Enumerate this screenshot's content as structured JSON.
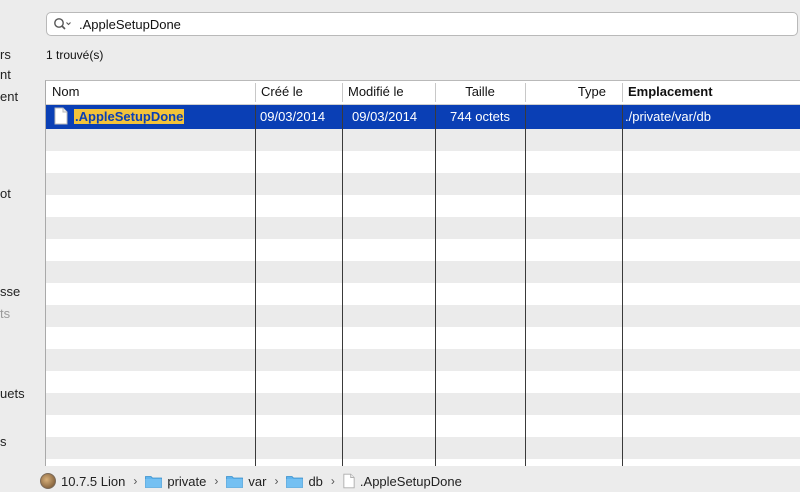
{
  "sidebar": {
    "fragments": [
      {
        "text": "rs",
        "dim": false
      },
      {
        "text": "nt",
        "dim": false
      },
      {
        "text": "ent",
        "dim": false
      },
      {
        "text": "ot",
        "dim": false
      },
      {
        "text": "sse",
        "dim": false
      },
      {
        "text": "ts",
        "dim": true
      },
      {
        "text": "uets",
        "dim": false
      },
      {
        "text": "s",
        "dim": false
      }
    ]
  },
  "search": {
    "icon": "magnifier-icon",
    "value": ".AppleSetupDone"
  },
  "results_count": "1 trouvé(s)",
  "table": {
    "columns": [
      "Nom",
      "Créé le",
      "Modifié le",
      "Taille",
      "Type",
      "Emplacement"
    ],
    "rows": [
      {
        "name": ".AppleSetupDone",
        "created": "09/03/2014",
        "modified": "09/03/2014",
        "size": "744 octets",
        "type": "",
        "location": "./private/var/db",
        "selected": true
      }
    ],
    "colors": {
      "selection": "#0a3fb5",
      "name_highlight": "#f3c33a"
    }
  },
  "pathbar": {
    "items": [
      {
        "label": "10.7.5 Lion",
        "icon": "disk-icon"
      },
      {
        "label": "private",
        "icon": "folder-icon"
      },
      {
        "label": "var",
        "icon": "folder-icon"
      },
      {
        "label": "db",
        "icon": "folder-icon"
      },
      {
        "label": ".AppleSetupDone",
        "icon": "file-icon"
      }
    ],
    "separator": "›"
  }
}
